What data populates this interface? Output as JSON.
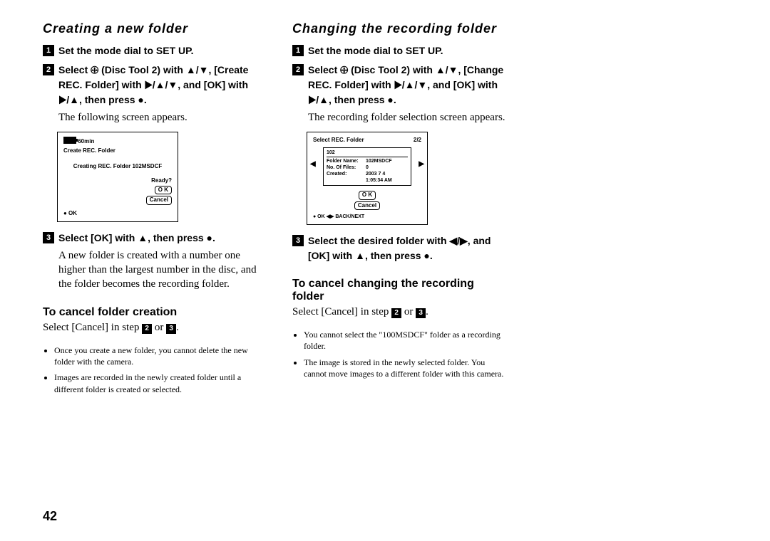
{
  "page_number": "42",
  "left": {
    "heading": "Creating a new folder",
    "step1": "Set the mode dial to SET UP.",
    "step2": "Select 🕀 (Disc Tool 2) with ▲/▼, [Create REC. Folder] with ▶/▲/▼, and [OK] with ▶/▲, then press ●.",
    "after2": "The following screen appears.",
    "step3": "Select [OK] with ▲, then press ●.",
    "after3": "A new folder is created with a number one higher than the largest number in the disc, and the folder becomes the recording folder.",
    "sub_heading": "To cancel folder creation",
    "cancel_text_a": "Select [Cancel] in step ",
    "cancel_text_b": " or ",
    "cancel_text_c": ".",
    "notes": [
      "Once you create a new folder, you cannot delete the new folder with the camera.",
      "Images are recorded in the newly created folder until a different folder is created or selected."
    ],
    "lcd": {
      "battery": "60min",
      "title": "Create REC. Folder",
      "line1": "Creating REC. Folder 102MSDCF",
      "ready": "Ready?",
      "ok": "O K",
      "cancel": "Cancel",
      "footer": "● OK"
    }
  },
  "right": {
    "heading": "Changing the recording folder",
    "step1": "Set the mode dial to SET UP.",
    "step2": "Select 🕀 (Disc Tool 2) with ▲/▼, [Change REC. Folder] with ▶/▲/▼, and [OK] with ▶/▲, then press ●.",
    "after2": "The recording folder selection screen appears.",
    "step3": "Select the desired folder with ◀/▶, and [OK] with ▲, then press ●.",
    "sub_heading": "To cancel changing the recording folder",
    "cancel_text_a": "Select [Cancel] in step ",
    "cancel_text_b": " or ",
    "cancel_text_c": ".",
    "notes": [
      "You cannot select the \"100MSDCF\" folder as a recording folder.",
      "The image is stored in the newly selected folder. You cannot move images to a different folder with this camera."
    ],
    "lcd": {
      "title": "Select REC. Folder",
      "page": "2/2",
      "folder_num": "102",
      "row1_label": "Folder Name:",
      "row1_val": "102MSDCF",
      "row2_label": "No. Of Files:",
      "row2_val": "0",
      "row3_label": "Created:",
      "row3_val_a": "2003   7   4",
      "row3_val_b": "1:05:34 AM",
      "ok": "O K",
      "cancel": "Cancel",
      "footer": "●  OK     ◀▶ BACK/NEXT"
    }
  }
}
